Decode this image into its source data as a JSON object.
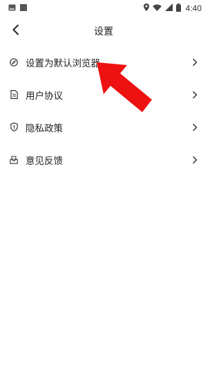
{
  "status_bar": {
    "time": "4:40",
    "icons": [
      "image-icon",
      "square-icon",
      "location-icon",
      "wifi-icon",
      "signal-icon",
      "battery-icon"
    ]
  },
  "header": {
    "title": "设置",
    "back_icon": "chevron-left-icon"
  },
  "settings": {
    "items": [
      {
        "label": "设置为默认浏览器",
        "icon": "compass-icon"
      },
      {
        "label": "用户协议",
        "icon": "document-icon"
      },
      {
        "label": "隐私政策",
        "icon": "shield-icon"
      },
      {
        "label": "意见反馈",
        "icon": "inbox-icon"
      }
    ]
  },
  "annotation": {
    "type": "arrow",
    "color": "#ee1111"
  }
}
